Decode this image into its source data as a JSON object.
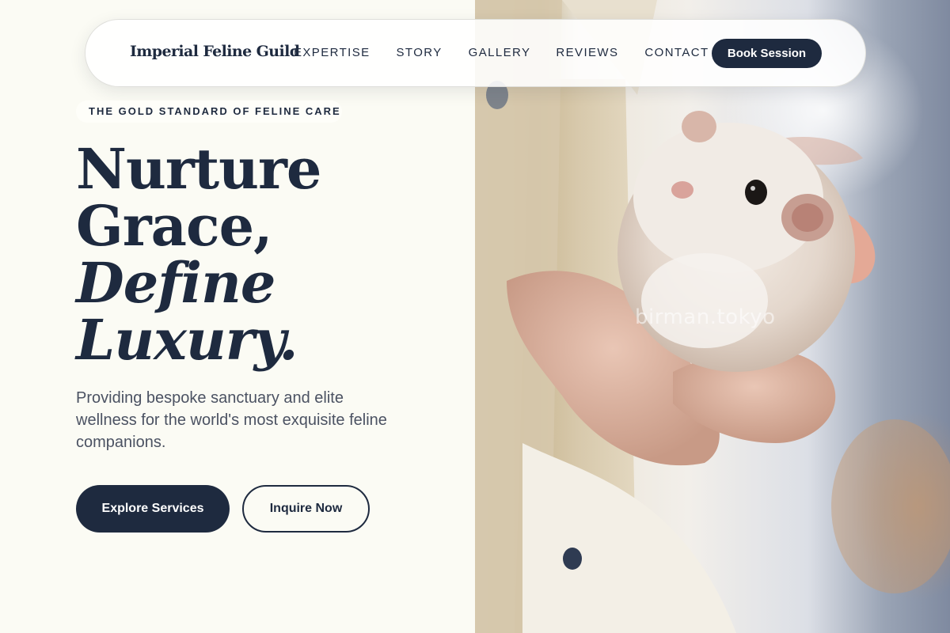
{
  "nav": {
    "brand": "Imperial Feline Guild",
    "links": [
      "EXPERTISE",
      "STORY",
      "GALLERY",
      "REVIEWS",
      "CONTACT"
    ],
    "cta": "Book Session"
  },
  "hero": {
    "eyebrow": "THE GOLD STANDARD OF FELINE CARE",
    "headline": {
      "line1": "Nurture",
      "line2": "Grace,",
      "line3": "Define",
      "line4": "Luxury."
    },
    "subtext": "Providing bespoke sanctuary and elite wellness for the world's most exquisite feline companions.",
    "primary_button": "Explore Services",
    "secondary_button": "Inquire Now"
  },
  "image": {
    "watermark": "birman.tokyo",
    "subject": "hamster-held-in-hand"
  },
  "colors": {
    "navy": "#1e2a3f",
    "cream_background": "#fbfbf4",
    "body_text": "#4b5262"
  }
}
